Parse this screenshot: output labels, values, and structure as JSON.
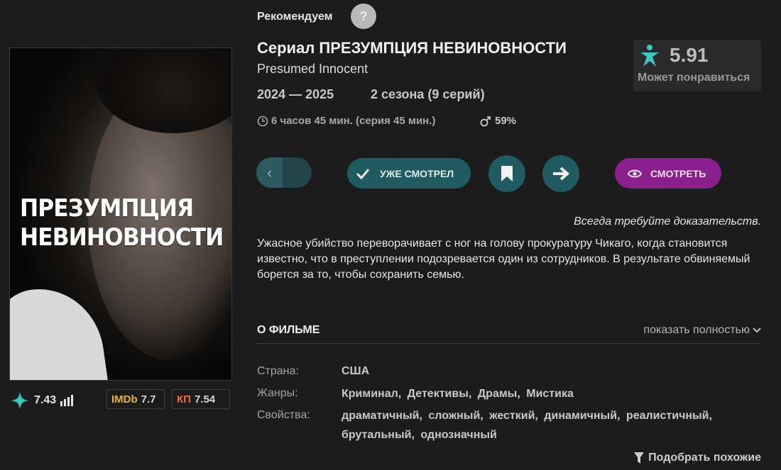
{
  "header": {
    "recommend_label": "Рекомендуем",
    "help_icon": "?",
    "title": "Сериал ПРЕЗУМПЦИЯ НЕВИНОВНОСТИ",
    "original_title": "Presumed Innocent",
    "years": "2024 — 2025",
    "seasons": "2 сезона (9 серий)",
    "duration": "6 часов 45 мин. (серия 45 мин.)",
    "male_percent": "59%"
  },
  "poster": {
    "title_line1": "ПРЕЗУМПЦИЯ",
    "title_line2": "НЕВИНОВНОСТИ"
  },
  "ratings": {
    "site_rating": "7.43",
    "imdb_label": "IMDb",
    "imdb_value": "7.7",
    "kp_label": "КП",
    "kp_value": "7.54"
  },
  "score_panel": {
    "score": "5.91",
    "hint": "Может понравиться"
  },
  "actions": {
    "watched_label": "УЖЕ СМОТРЕЛ",
    "watch_label": "СМОТРЕТЬ"
  },
  "tagline": "Всегда требуйте доказательств.",
  "description": "Ужасное убийство переворачивает с ног на голову прокуратуру Чикаго, когда становится известно, что в преступлении подозревается один из сотрудников. В результате обвиняемый борется за то, чтобы сохранить семью.",
  "about": {
    "heading": "О ФИЛЬМЕ",
    "show_full": "показать полностью",
    "country_label": "Страна:",
    "country": "США",
    "genres_label": "Жанры:",
    "genres": [
      "Криминал,",
      "Детективы,",
      "Драмы,",
      "Мистика"
    ],
    "properties_label": "Свойства:",
    "properties": [
      "драматичный,",
      "сложный,",
      "жесткий,",
      "динамичный,",
      "реалистичный,",
      "брутальный,",
      "однозначный"
    ]
  },
  "similar_label": "Подобрать похожие",
  "colors": {
    "background": "#1c1c1c",
    "teal_button": "#1f5b61",
    "watch_button": "#8b1f8d",
    "imdb": "#e5b630",
    "kp": "#f26a2a",
    "accent_teal": "#3fc7c7"
  }
}
